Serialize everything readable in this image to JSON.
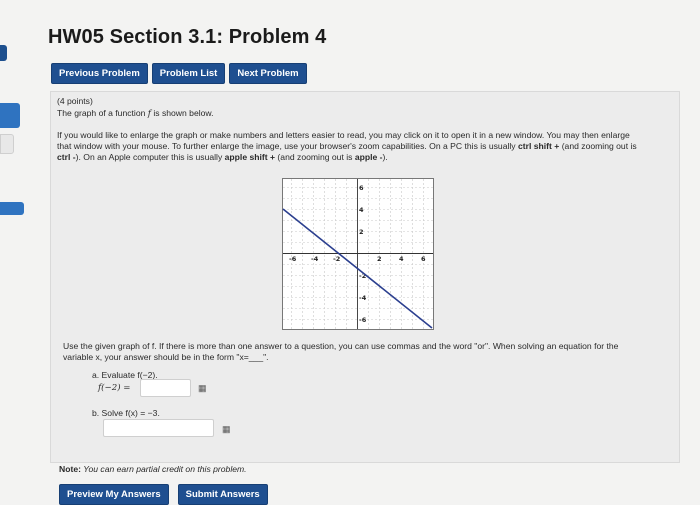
{
  "page": {
    "title": "HW05 Section 3.1: Problem 4"
  },
  "nav": {
    "previous": "Previous Problem",
    "list": "Problem List",
    "next": "Next Problem"
  },
  "problem": {
    "points": "(4 points)",
    "intro_prefix": "The graph of a function ",
    "intro_var": "f",
    "intro_suffix": " is shown below.",
    "zoom_line1": "If you would like to enlarge the graph or make numbers and letters easier to read, you may click on it to open it in a new window. You may then enlarge",
    "zoom_line2": "that window with your mouse. To further enlarge the image, use your browser's zoom capabilities. On a PC this is usually ",
    "zoom_line2_bold": "ctrl shift +",
    "zoom_line2_end": " (and zooming out is",
    "zoom_line3_bold1": "ctrl -",
    "zoom_line3_mid": "). On an Apple computer this is usually ",
    "zoom_line3_bold2": "apple shift +",
    "zoom_line3_mid2": " (and zooming out is ",
    "zoom_line3_bold3": "apple -",
    "zoom_line3_end": ").",
    "instructions_line1": "Use the given graph of f. If there is more than one answer to a question, you can use commas and the word \"or\". When solving an equation for the",
    "instructions_line2": "variable x, your answer should be in the form \"x=___\".",
    "part_a_label": "a. Evaluate f(−2).",
    "part_a_prompt": "f(−2) =",
    "part_a_value": "",
    "part_b_label": "b. Solve f(x) = −3.",
    "part_b_value": "",
    "note_label": "Note:",
    "note_text": " You can earn partial credit on this problem."
  },
  "graph": {
    "x_ticks": [
      "-6",
      "-4",
      "-2",
      "2",
      "4",
      "6"
    ],
    "y_ticks": [
      "6",
      "4",
      "2",
      "-2",
      "-4",
      "-6"
    ]
  },
  "actions": {
    "preview": "Preview My Answers",
    "submit": "Submit Answers"
  }
}
